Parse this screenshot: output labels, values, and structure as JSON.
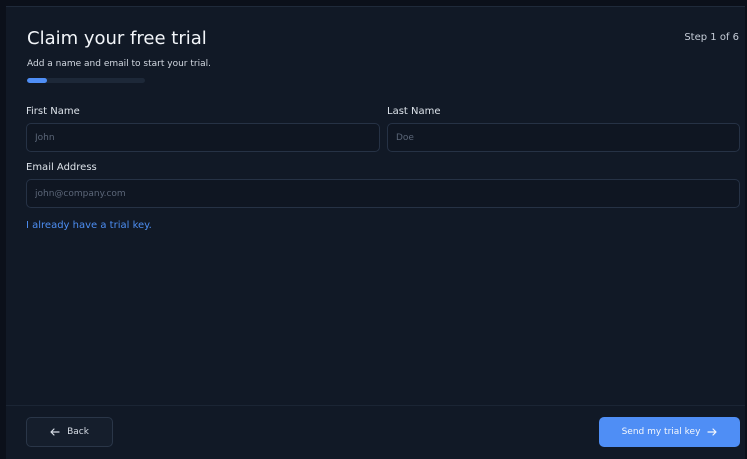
{
  "header": {
    "title": "Claim your free trial",
    "step": "Step 1 of 6",
    "subtitle": "Add a name and email to start your trial."
  },
  "progress": {
    "current_step": 1,
    "total_steps": 6,
    "fill_percent": 16.7,
    "color": "#4f8ef5"
  },
  "form": {
    "first_name": {
      "label": "First Name",
      "placeholder": "John",
      "value": ""
    },
    "last_name": {
      "label": "Last Name",
      "placeholder": "Doe",
      "value": ""
    },
    "email": {
      "label": "Email Address",
      "placeholder": "john@company.com",
      "value": ""
    }
  },
  "trial_key_link": "I already have a trial key.",
  "footer": {
    "back_label": "Back",
    "back_icon": "arrow-left-icon",
    "send_label": "Send my trial key",
    "send_icon": "arrow-right-icon"
  },
  "colors": {
    "background": "#111926",
    "accent": "#4f8ef5",
    "link": "#4d8ef2"
  }
}
